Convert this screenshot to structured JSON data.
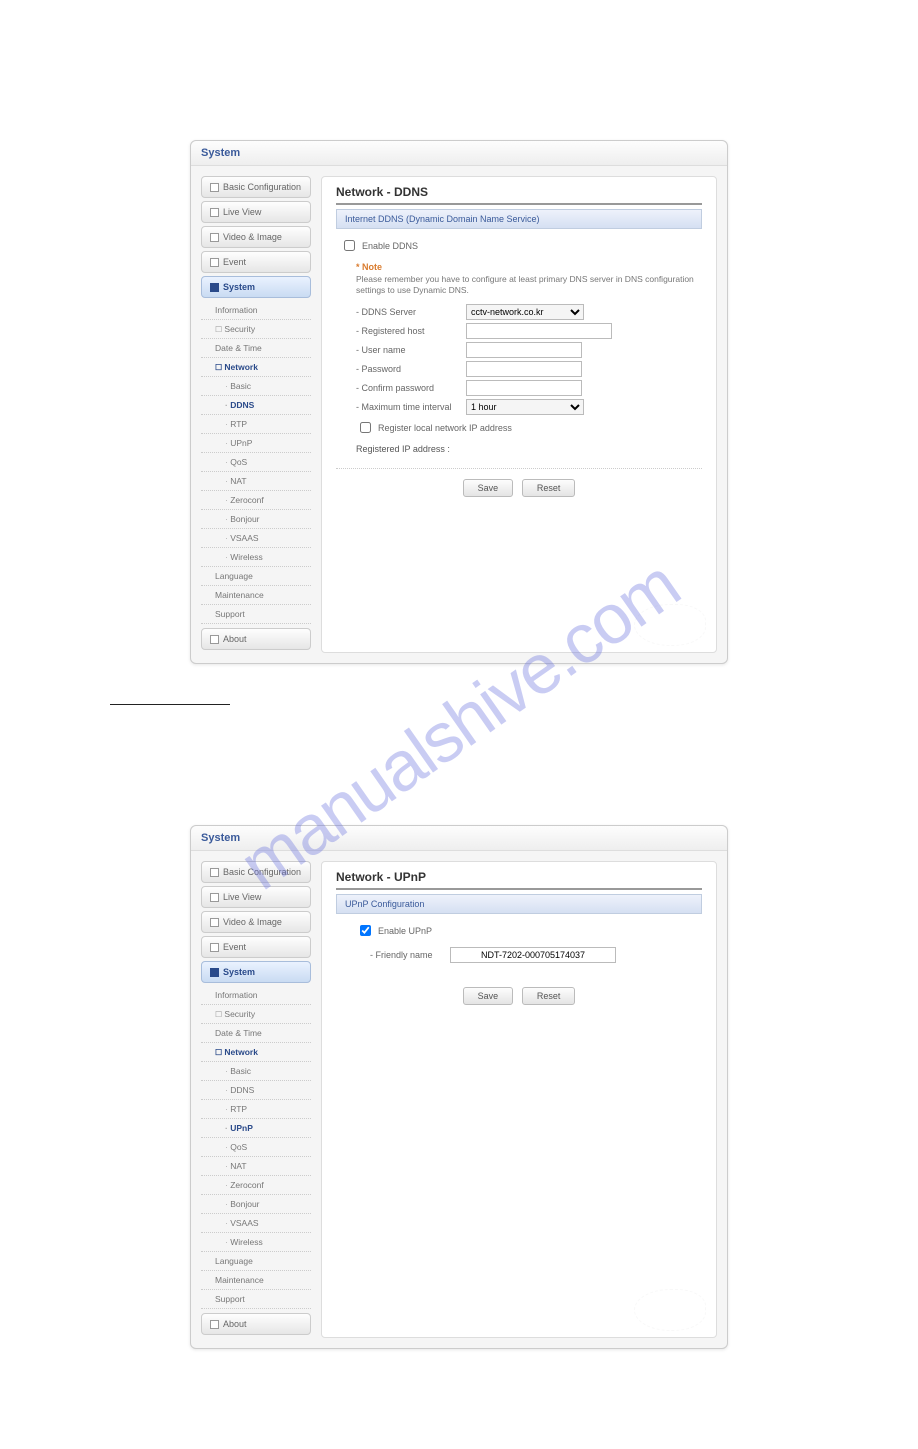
{
  "panel1": {
    "header": "System",
    "sidebar": {
      "basic_config": "Basic Configuration",
      "live_view": "Live View",
      "video_image": "Video & Image",
      "event": "Event",
      "system": "System",
      "about": "About",
      "sub": {
        "information": "Information",
        "security": "Security",
        "date_time": "Date & Time",
        "network": "Network",
        "basic": "Basic",
        "ddns": "DDNS",
        "rtp": "RTP",
        "upnp": "UPnP",
        "qos": "QoS",
        "nat": "NAT",
        "zeroconf": "Zeroconf",
        "bonjour": "Bonjour",
        "vsaas": "VSAAS",
        "wireless": "Wireless",
        "language": "Language",
        "maintenance": "Maintenance",
        "support": "Support"
      }
    },
    "content": {
      "title": "Network - DDNS",
      "section": "Internet DDNS (Dynamic Domain Name Service)",
      "enable_label": "Enable DDNS",
      "note_title": "* Note",
      "note_text": "Please remember you have to configure at least primary DNS server in DNS configuration settings to use Dynamic DNS.",
      "fields": {
        "ddns_server": "- DDNS Server",
        "ddns_server_value": "cctv-network.co.kr",
        "registered_host": "- Registered host",
        "user_name": "- User name",
        "password": "- Password",
        "confirm_password": "- Confirm password",
        "max_interval": "- Maximum time interval",
        "max_interval_value": "1 hour",
        "register_local": "Register local network IP address",
        "registered_ip": "Registered IP address :"
      },
      "save": "Save",
      "reset": "Reset"
    }
  },
  "panel2": {
    "header": "System",
    "content": {
      "title": "Network - UPnP",
      "section": "UPnP Configuration",
      "enable_label": "Enable UPnP",
      "friendly_name_label": "- Friendly name",
      "friendly_name_value": "NDT-7202-000705174037",
      "save": "Save",
      "reset": "Reset"
    }
  },
  "watermark": "manualshive.com"
}
